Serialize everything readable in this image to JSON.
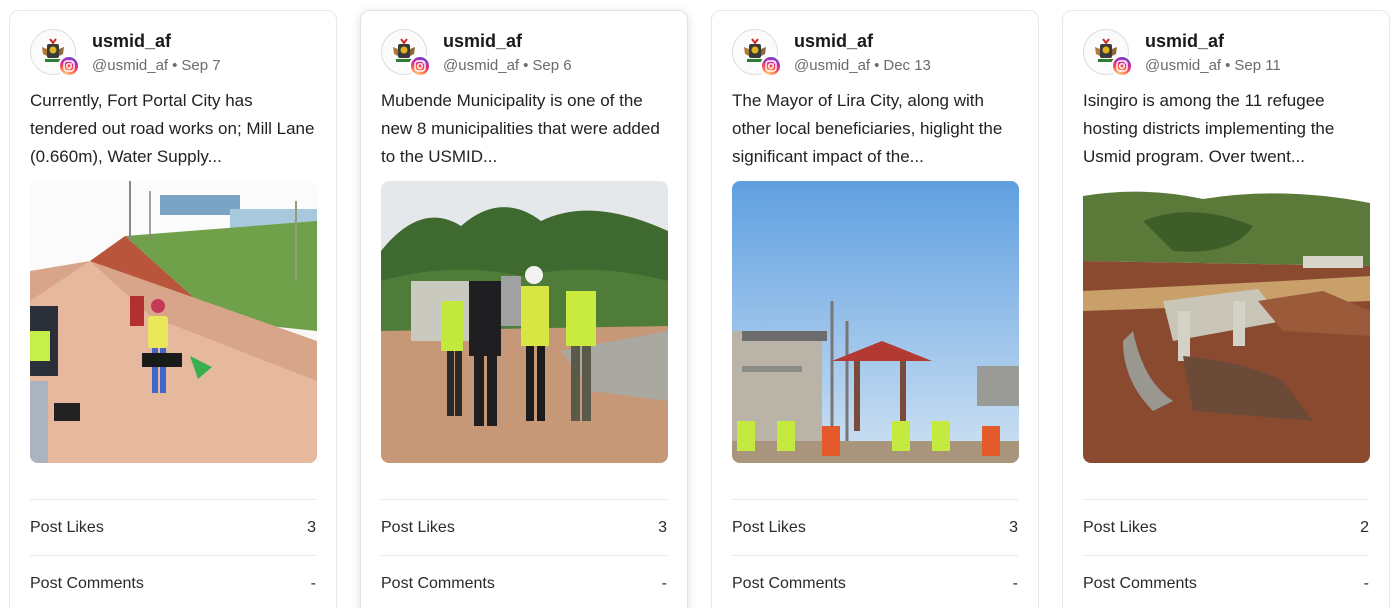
{
  "posts": [
    {
      "username": "usmid_af",
      "handle": "@usmid_af",
      "date": "Sep 7",
      "text": "Currently, Fort Portal City has tendered out road works on; Mill Lane (0.660m), Water Supply...",
      "likes_label": "Post Likes",
      "likes": "3",
      "comments_label": "Post Comments",
      "comments": "-"
    },
    {
      "username": "usmid_af",
      "handle": "@usmid_af",
      "date": "Sep 6",
      "text": "Mubende Municipality is one of the new 8 municipalities that were added to the USMID...",
      "likes_label": "Post Likes",
      "likes": "3",
      "comments_label": "Post Comments",
      "comments": "-"
    },
    {
      "username": "usmid_af",
      "handle": "@usmid_af",
      "date": "Dec 13",
      "text": "The Mayor of Lira City, along with other local beneficiaries, higlight the significant impact of the...",
      "likes_label": "Post Likes",
      "likes": "3",
      "comments_label": "Post Comments",
      "comments": "-"
    },
    {
      "username": "usmid_af",
      "handle": "@usmid_af",
      "date": "Sep 11",
      "text": "Isingiro is among the 11 refugee hosting districts implementing the Usmid program. Over twent...",
      "likes_label": "Post Likes",
      "likes": "2",
      "comments_label": "Post Comments",
      "comments": "-"
    }
  ],
  "icons": {
    "avatar": "uganda-coat-of-arms-icon",
    "badge": "instagram-icon"
  },
  "colors": {
    "card_border": "#e8e8e8",
    "meta_text": "#6b6b6b"
  }
}
